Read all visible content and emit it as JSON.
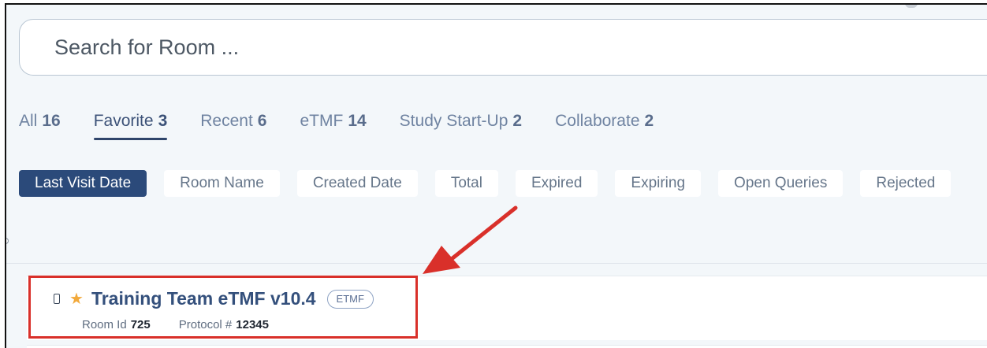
{
  "search": {
    "placeholder": "Search for Room ..."
  },
  "tabs": [
    {
      "label": "All",
      "count": "16"
    },
    {
      "label": "Favorite",
      "count": "3"
    },
    {
      "label": "Recent",
      "count": "6"
    },
    {
      "label": "eTMF",
      "count": "14"
    },
    {
      "label": "Study Start-Up",
      "count": "2"
    },
    {
      "label": "Collaborate",
      "count": "2"
    }
  ],
  "active_tab": "Favorite",
  "sort_options": [
    "Last Visit Date",
    "Room Name",
    "Created Date",
    "Total",
    "Expired",
    "Expiring",
    "Open Queries",
    "Rejected"
  ],
  "active_sort": "Last Visit Date",
  "rooms": [
    {
      "name": "Training Team eTMF v10.4",
      "tag": "ETMF",
      "favorite": true,
      "room_id_label": "Room Id",
      "room_id": "725",
      "protocol_label": "Protocol #",
      "protocol": "12345"
    }
  ],
  "icons": {
    "favorite": "star-icon",
    "device": "phone-icon"
  },
  "colors": {
    "accent": "#2b4a7a",
    "star": "#f2a93b",
    "annotation": "#d9302a"
  }
}
